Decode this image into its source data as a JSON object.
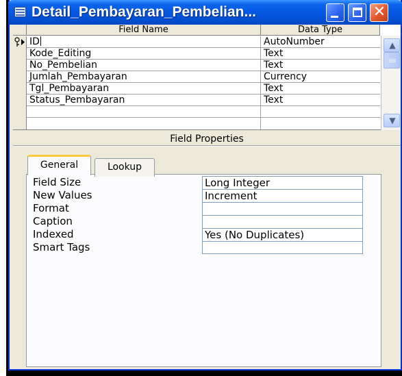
{
  "window": {
    "title": "Detail_Pembayaran_Pembelian...",
    "title_colors": {
      "bar": "#0556e0",
      "close": "#e2582c"
    }
  },
  "grid": {
    "columns": [
      "Field Name",
      "Data Type"
    ],
    "rows": [
      {
        "name": "ID",
        "type": "AutoNumber",
        "primary_key": true,
        "current": true
      },
      {
        "name": "Kode_Editing",
        "type": "Text"
      },
      {
        "name": "No_Pembelian",
        "type": "Text"
      },
      {
        "name": "Jumlah_Pembayaran",
        "type": "Currency"
      },
      {
        "name": "Tgl_Pembayaran",
        "type": "Text"
      },
      {
        "name": "Status_Pembayaran",
        "type": "Text"
      },
      {
        "name": "",
        "type": ""
      },
      {
        "name": "",
        "type": ""
      }
    ]
  },
  "field_properties": {
    "heading": "Field Properties",
    "tabs": [
      {
        "label": "General",
        "active": true
      },
      {
        "label": "Lookup",
        "active": false
      }
    ],
    "properties": [
      {
        "label": "Field Size",
        "value": "Long Integer"
      },
      {
        "label": "New Values",
        "value": "Increment"
      },
      {
        "label": "Format",
        "value": ""
      },
      {
        "label": "Caption",
        "value": ""
      },
      {
        "label": "Indexed",
        "value": "Yes (No Duplicates)"
      },
      {
        "label": "Smart Tags",
        "value": ""
      }
    ]
  },
  "icons": {
    "key": "primary-key-icon",
    "row_pointer": "current-row-pointer-icon"
  }
}
